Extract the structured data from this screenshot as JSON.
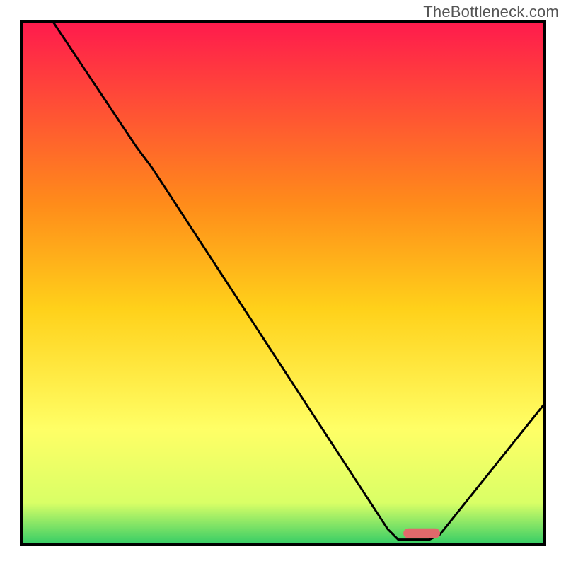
{
  "watermark": "TheBottleneck.com",
  "chart_data": {
    "type": "line",
    "title": "",
    "xlabel": "",
    "ylabel": "",
    "xlim": [
      0,
      100
    ],
    "ylim": [
      0,
      100
    ],
    "gradient_colors": {
      "top": "#ff1a4d",
      "upper_mid": "#ff8c1a",
      "mid": "#ffd11a",
      "lower_mid": "#ffff66",
      "near_bottom": "#d9ff66",
      "bottom": "#33cc66"
    },
    "curve_points": [
      {
        "x": 6,
        "y": 100
      },
      {
        "x": 22,
        "y": 76
      },
      {
        "x": 25,
        "y": 72
      },
      {
        "x": 70,
        "y": 3
      },
      {
        "x": 72,
        "y": 1
      },
      {
        "x": 78,
        "y": 1
      },
      {
        "x": 80,
        "y": 2
      },
      {
        "x": 100,
        "y": 27
      }
    ],
    "marker": {
      "x_start": 73,
      "x_end": 80,
      "y": 2.2,
      "color": "#e0696b"
    },
    "plot_border_color": "#000000",
    "curve_color": "#000000"
  }
}
